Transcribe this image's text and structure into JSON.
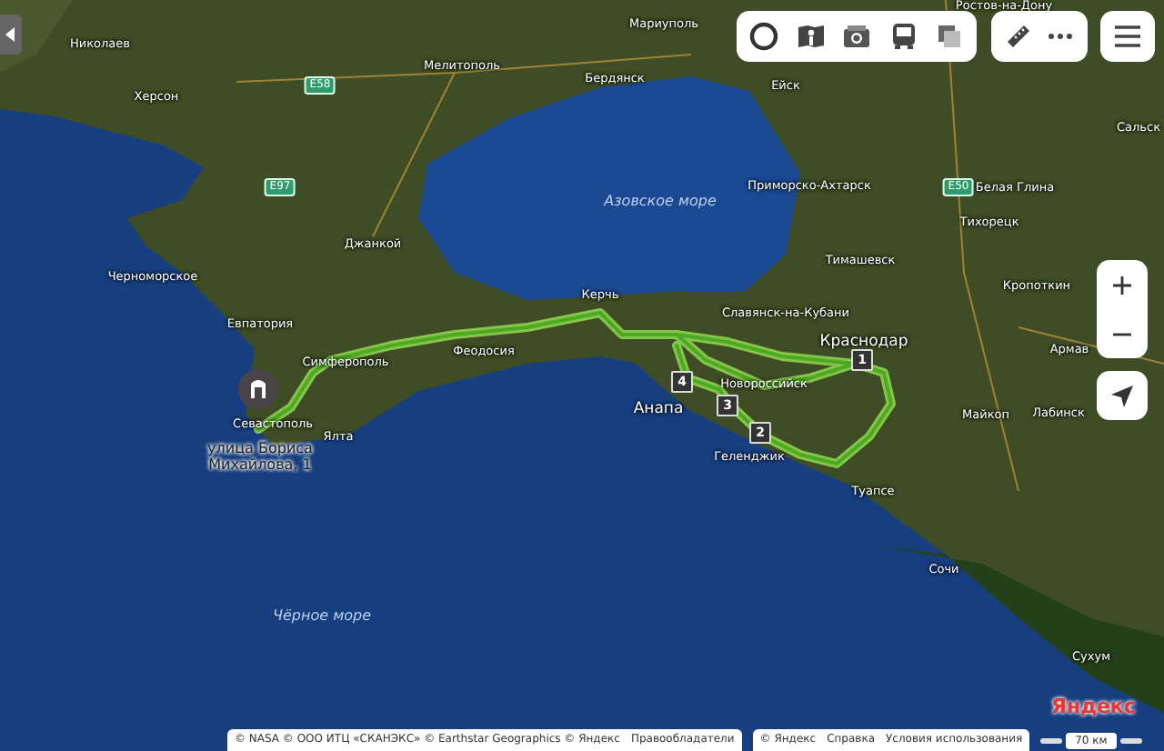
{
  "map": {
    "labels": [
      {
        "text": "Ростов-на-Дону",
        "kind": "city"
      },
      {
        "text": "Мариуполь",
        "kind": "city"
      },
      {
        "text": "Николаев",
        "kind": "city"
      },
      {
        "text": "Мелитополь",
        "kind": "city"
      },
      {
        "text": "Херсон",
        "kind": "city"
      },
      {
        "text": "E58",
        "kind": "road"
      },
      {
        "text": "Бердянск",
        "kind": "city"
      },
      {
        "text": "Ейск",
        "kind": "city"
      },
      {
        "text": "Сальск",
        "kind": "city"
      },
      {
        "text": "E97",
        "kind": "road"
      },
      {
        "text": "Азовское море",
        "kind": "sea"
      },
      {
        "text": "Приморско-Ахтарск",
        "kind": "city"
      },
      {
        "text": "E50",
        "kind": "road"
      },
      {
        "text": "Белая Глина",
        "kind": "city"
      },
      {
        "text": "Тихорецк",
        "kind": "city"
      },
      {
        "text": "Джанкой",
        "kind": "city"
      },
      {
        "text": "Тимашевск",
        "kind": "city"
      },
      {
        "text": "Черноморское",
        "kind": "city"
      },
      {
        "text": "Керчь",
        "kind": "city"
      },
      {
        "text": "Кропоткин",
        "kind": "city"
      },
      {
        "text": "Евпатория",
        "kind": "city"
      },
      {
        "text": "Славянск-на-Кубани",
        "kind": "city"
      },
      {
        "text": "Симферополь",
        "kind": "city"
      },
      {
        "text": "Феодосия",
        "kind": "city"
      },
      {
        "text": "Краснодар",
        "kind": "major"
      },
      {
        "text": "Армав",
        "kind": "city"
      },
      {
        "text": "Новороссийск",
        "kind": "city"
      },
      {
        "text": "Севастополь",
        "kind": "city"
      },
      {
        "text": "Анапа",
        "kind": "major"
      },
      {
        "text": "Майкоп",
        "kind": "city"
      },
      {
        "text": "Лабинск",
        "kind": "city"
      },
      {
        "text": "Ялта",
        "kind": "city"
      },
      {
        "text": "Геленджик",
        "kind": "city"
      },
      {
        "text": "Туапсе",
        "kind": "city"
      },
      {
        "text": "Сочи",
        "kind": "city"
      },
      {
        "text": "Чёрное море",
        "kind": "sea"
      },
      {
        "text": "Сухум",
        "kind": "city"
      }
    ]
  },
  "route": {
    "waypoints": [
      {
        "number": "1"
      },
      {
        "number": "2"
      },
      {
        "number": "3"
      },
      {
        "number": "4"
      }
    ]
  },
  "address_pin": {
    "label": "улица Бориса Михайлова, 1"
  },
  "attribution": {
    "copyright": "© NASA © ООО ИТЦ «СКАНЭКС» © Earthstar Geographics © Яндекс",
    "rights_link": "Правообладатели"
  },
  "footer_links": [
    "© Яндекс",
    "Справка",
    "Условия использования"
  ],
  "scale": "70 км",
  "logo": "Яндекс"
}
